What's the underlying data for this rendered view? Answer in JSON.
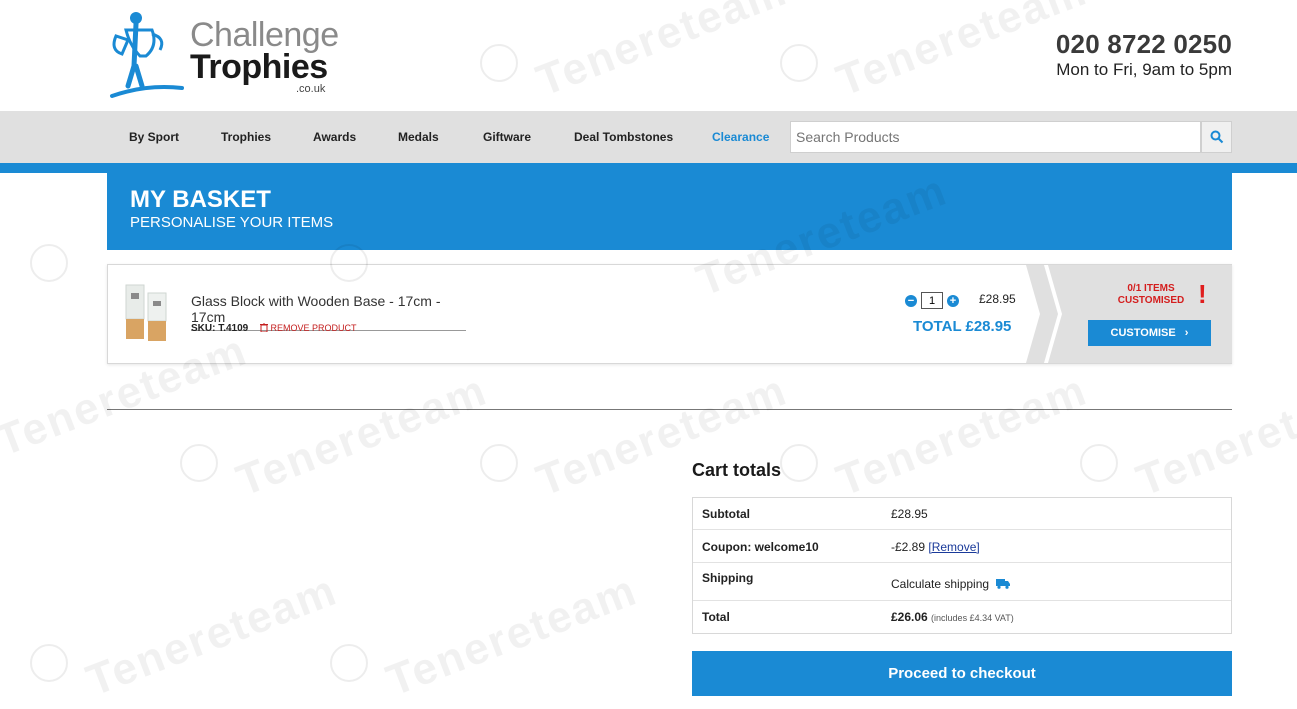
{
  "header": {
    "logo": {
      "line1": "Challenge",
      "line2": "Trophies",
      "line3": ".co.uk"
    },
    "phone": "020 8722 0250",
    "hours": "Mon to Fri, 9am to 5pm"
  },
  "nav": {
    "items": [
      "By Sport",
      "Trophies",
      "Awards",
      "Medals",
      "Giftware",
      "Deal Tombstones",
      "Clearance"
    ],
    "search_placeholder": "Search Products",
    "accent": "#1a8ad4"
  },
  "banner": {
    "title": "MY BASKET",
    "subtitle": "PERSONALISE YOUR ITEMS"
  },
  "product": {
    "name": "Glass Block with Wooden Base - 17cm - 17cm",
    "sku_label": "SKU: T.4109",
    "remove_label": "REMOVE PRODUCT",
    "quantity": "1",
    "price": "£28.95",
    "total": "TOTAL £28.95",
    "customised_count": "0/1 ITEMS",
    "customised_label": "CUSTOMISED",
    "customise_button": "CUSTOMISE"
  },
  "cart_totals": {
    "title": "Cart totals",
    "rows": [
      {
        "label": "Subtotal",
        "value": "£28.95"
      },
      {
        "label": "Coupon: welcome10",
        "value": "-£2.89",
        "link": "[Remove]"
      },
      {
        "label": "Shipping",
        "value": "Calculate shipping"
      },
      {
        "label": "Total",
        "value": "£26.06",
        "note": "(includes £4.34 VAT)"
      }
    ],
    "checkout_button": "Proceed to checkout"
  },
  "watermark": "Tenereteam"
}
